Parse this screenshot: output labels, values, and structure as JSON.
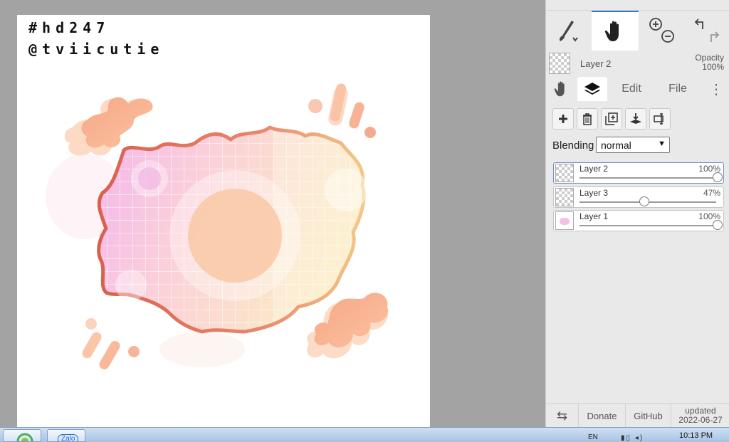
{
  "canvas": {
    "tag_line_1": "#hd247",
    "tag_line_2": "@tviicutie"
  },
  "toolbar": {
    "brush_icon": "brush-icon",
    "hand_icon": "hand-icon",
    "zoom_icon": "zoom-in-out-icon",
    "undo_icon": "undo-redo-icon"
  },
  "layer_summary": {
    "name": "Layer 2",
    "opacity_label": "Opacity",
    "opacity_value": "100%"
  },
  "tabs": {
    "edit": "Edit",
    "file": "File",
    "more": "⋮"
  },
  "blending": {
    "label": "Blending",
    "value": "normal"
  },
  "layers": [
    {
      "name": "Layer 2",
      "opacity": "100%",
      "fraction": 1.0
    },
    {
      "name": "Layer 3",
      "opacity": "47%",
      "fraction": 0.47
    },
    {
      "name": "Layer 1",
      "opacity": "100%",
      "fraction": 1.0
    }
  ],
  "footer": {
    "swap": "⇆",
    "donate": "Donate",
    "github": "GitHub",
    "updated_label": "updated",
    "updated_date": "2022-06-27"
  },
  "taskbar": {
    "zalo": "Zalo",
    "lang": "EN",
    "time": "10:13 PM"
  },
  "colors": {
    "accent": "#2f7ad1",
    "panel_bg": "#e9e9e9",
    "workspace_bg": "#a3a3a3"
  }
}
